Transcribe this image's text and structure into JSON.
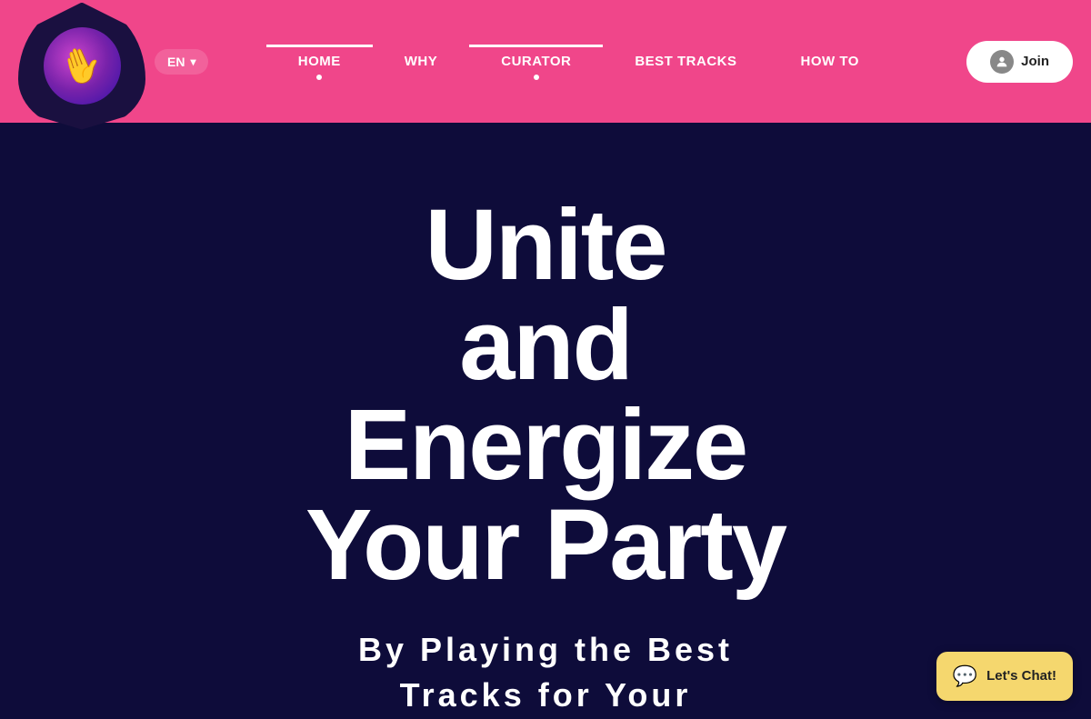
{
  "header": {
    "lang_label": "EN",
    "nav_items": [
      {
        "label": "HOME",
        "active": true
      },
      {
        "label": "WHY",
        "active": false
      },
      {
        "label": "CURATOR",
        "active": true
      },
      {
        "label": "BEST TRACKS",
        "active": false
      },
      {
        "label": "HOW TO",
        "active": false
      }
    ],
    "join_button": "Join"
  },
  "hero": {
    "line1": "Unite",
    "line2": "and",
    "line3": "Energize",
    "line4": "Your Party",
    "subtitle_line1": "By Playing the Best",
    "subtitle_line2": "Tracks for Your"
  },
  "chat": {
    "label": "Let's Chat!"
  }
}
